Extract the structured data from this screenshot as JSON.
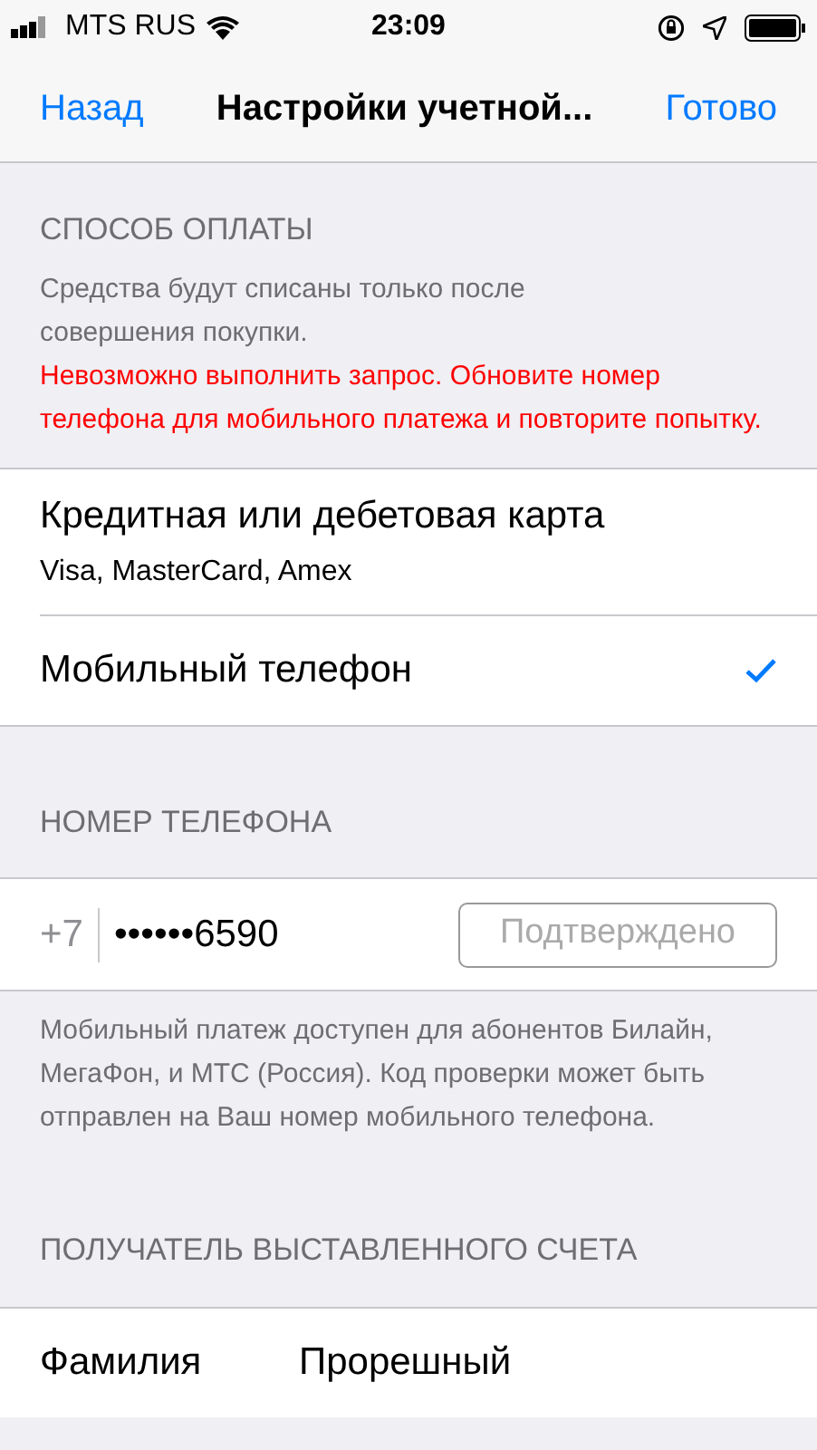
{
  "status_bar": {
    "carrier": "MTS RUS",
    "time": "23:09"
  },
  "nav": {
    "back": "Назад",
    "title": "Настройки учетной...",
    "done": "Готово"
  },
  "payment": {
    "header": "СПОСОБ ОПЛАТЫ",
    "note": "Средства будут списаны только после совершения покупки.",
    "error": "Невозможно выполнить запрос. Обновите номер телефона для мобильного платежа и повторите попытку.",
    "options": [
      {
        "title": "Кредитная или дебетовая карта",
        "subtitle": "Visa, MasterCard, Amex",
        "selected": false
      },
      {
        "title": "Мобильный телефон",
        "selected": true
      }
    ]
  },
  "phone": {
    "header": "НОМЕР ТЕЛЕФОНА",
    "prefix": "+7",
    "value": "••••••6590",
    "status": "Подтверждено",
    "footer": "Мобильный платеж доступен для абонентов Билайн, МегаФон, и МТС (Россия). Код проверки может быть отправлен на Ваш номер мобильного телефона."
  },
  "billing": {
    "header": "ПОЛУЧАТЕЛЬ ВЫСТАВЛЕННОГО СЧЕТА",
    "fields": [
      {
        "label": "Фамилия",
        "value": "Прорешный"
      }
    ]
  }
}
